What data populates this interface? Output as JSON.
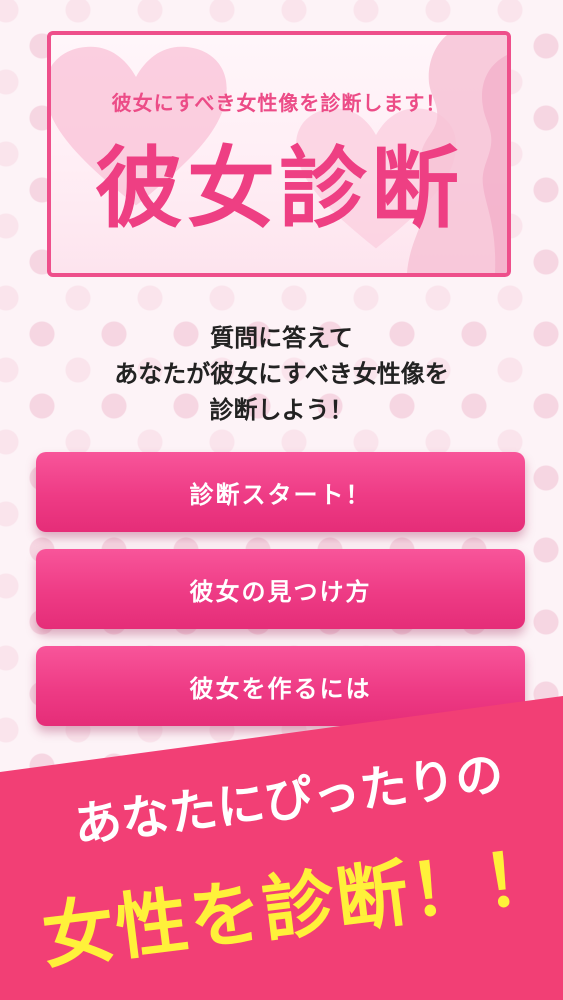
{
  "header": {
    "subtitle": "彼女にすべき女性像を診断します！",
    "title": "彼女診断"
  },
  "description": {
    "lines": [
      "質問に答えて",
      "あなたが彼女にすべき女性像を",
      "診断しよう！"
    ]
  },
  "buttons": {
    "start": "診断スタート！",
    "find": "彼女の見つけ方",
    "make": "彼女を作るには"
  },
  "banner": {
    "line1": "あなたにぴったりの",
    "line2": "女性を診断！！"
  },
  "colors": {
    "accent": "#ee3f83",
    "banner_bg": "#f23f75",
    "banner_highlight": "#fff13a",
    "background": "#fdf3f7"
  }
}
